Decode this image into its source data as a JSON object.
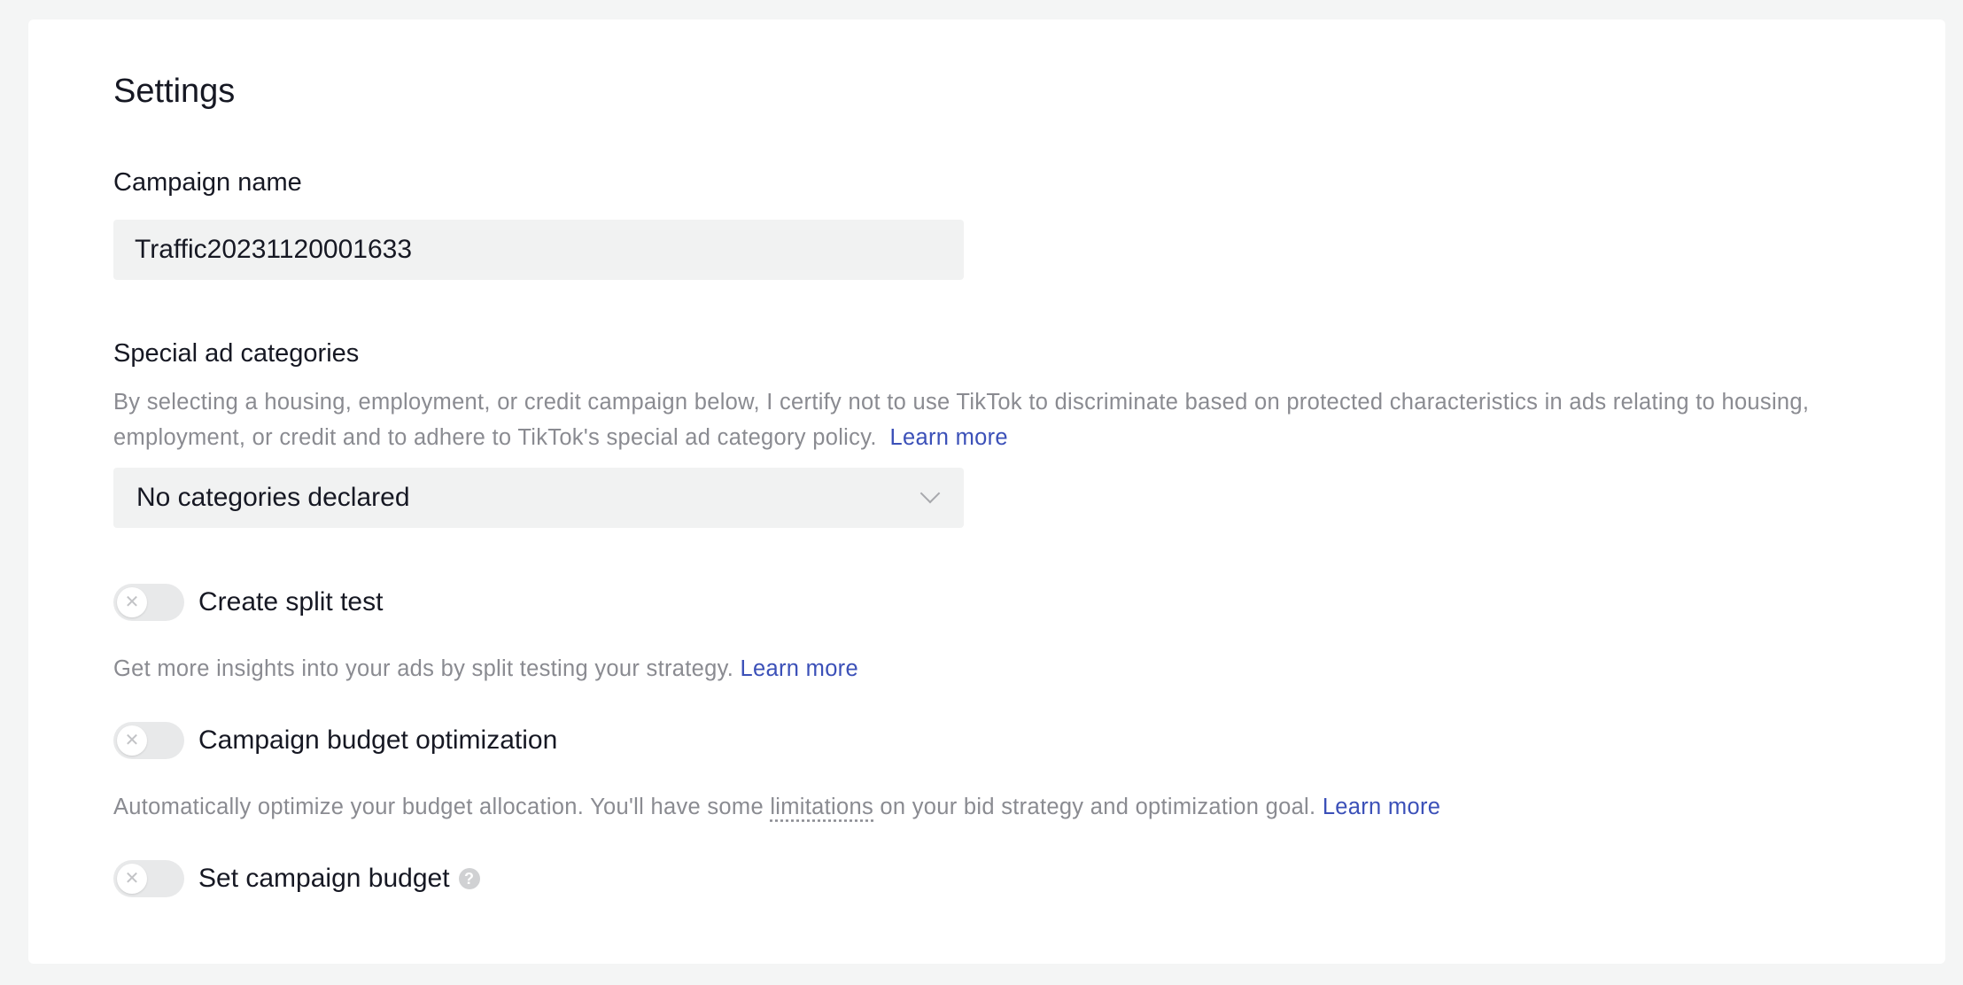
{
  "page": {
    "title": "Settings"
  },
  "campaign_name": {
    "label": "Campaign name",
    "value": "Traffic20231120001633"
  },
  "special_ad_categories": {
    "label": "Special ad categories",
    "description": "By selecting a housing, employment, or credit campaign below, I certify not to use TikTok to discriminate based on protected characteristics in ads relating to housing, employment, or credit and to adhere to TikTok's special ad category policy.",
    "learn_more": "Learn more",
    "selected": "No categories declared",
    "dropdown_icon": "chevron-down-icon"
  },
  "split_test": {
    "label": "Create split test",
    "enabled": false,
    "description": "Get more insights into your ads by split testing your strategy.",
    "learn_more": "Learn more"
  },
  "budget_optimization": {
    "label": "Campaign budget optimization",
    "enabled": false,
    "description_before": "Automatically optimize your budget allocation. You'll have some",
    "description_term": "limitations",
    "description_after": "on your bid strategy and optimization goal.",
    "learn_more": "Learn more"
  },
  "campaign_budget": {
    "label": "Set campaign budget",
    "enabled": false,
    "help_icon": "question-icon",
    "help_glyph": "?"
  },
  "toggle_off_glyph": "✕",
  "colors": {
    "link": "#3b50b8",
    "muted_text": "#8a8b91",
    "input_bg": "#f1f2f2",
    "toggle_off_bg": "#e8e9ea"
  }
}
